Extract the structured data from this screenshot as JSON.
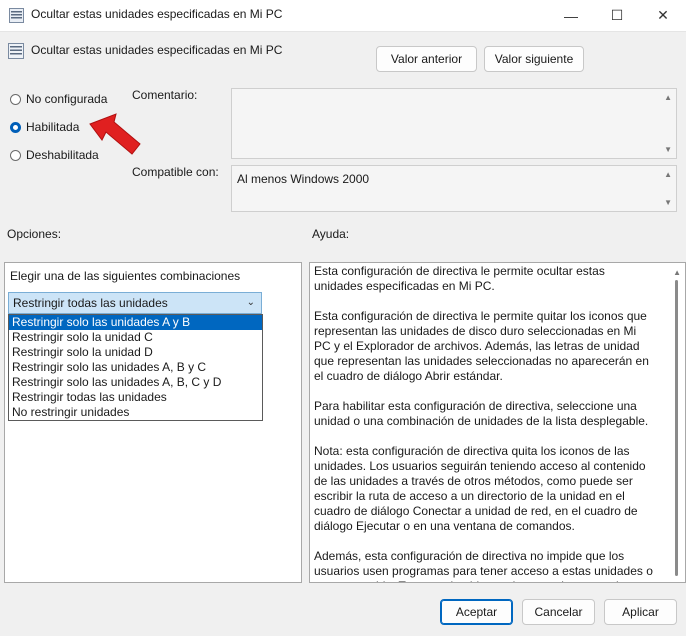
{
  "window": {
    "title": "Ocultar estas unidades especificadas en Mi PC",
    "minimize_glyph": "—",
    "maximize_glyph": "☐",
    "close_glyph": "✕"
  },
  "header": {
    "policy_name": "Ocultar estas unidades especificadas en Mi PC",
    "prev_button": "Valor anterior",
    "next_button": "Valor siguiente"
  },
  "state": {
    "options": [
      {
        "label": "No configurada",
        "checked": false
      },
      {
        "label": "Habilitada",
        "checked": true
      },
      {
        "label": "Deshabilitada",
        "checked": false
      }
    ]
  },
  "comment": {
    "label": "Comentario:",
    "value": ""
  },
  "compatible": {
    "label": "Compatible con:",
    "value": "Al menos Windows 2000"
  },
  "options_section": {
    "label": "Opciones:",
    "prompt": "Elegir una de las siguientes combinaciones",
    "selected": "Restringir todas las unidades",
    "list": [
      "Restringir solo las unidades A y B",
      "Restringir solo la unidad C",
      "Restringir solo la unidad D",
      "Restringir solo las unidades A, B y C",
      "Restringir solo las unidades A, B, C y D",
      "Restringir todas las unidades",
      "No restringir unidades"
    ],
    "highlighted_index": 0
  },
  "help_section": {
    "label": "Ayuda:",
    "paragraphs": [
      "Esta configuración de directiva le permite ocultar estas unidades especificadas en Mi PC.",
      "Esta configuración de directiva le permite quitar los iconos que representan las unidades de disco duro seleccionadas en Mi PC y el Explorador de archivos. Además, las letras de unidad que representan las unidades seleccionadas no aparecerán en el cuadro de diálogo Abrir estándar.",
      "Para habilitar esta configuración de directiva, seleccione una unidad o una combinación de unidades de la lista desplegable.",
      "Nota: esta configuración de directiva quita los iconos de las unidades. Los usuarios seguirán teniendo acceso al contenido de las unidades a través de otros métodos, como puede ser escribir la ruta de acceso a un directorio de la unidad en el cuadro de diálogo Conectar a unidad de red, en el cuadro de diálogo Ejecutar o en una ventana de comandos.",
      "Además, esta configuración de directiva no impide que los usuarios usen programas para tener acceso a estas unidades o a su contenido. Tampoco impide que los usuarios usen el complemento Administración de discos para ver y cambiar las características de la unidad."
    ]
  },
  "footer": {
    "accept": "Aceptar",
    "cancel": "Cancelar",
    "apply": "Aplicar"
  },
  "colors": {
    "accent": "#0067c0",
    "arrow": "#e02020"
  }
}
